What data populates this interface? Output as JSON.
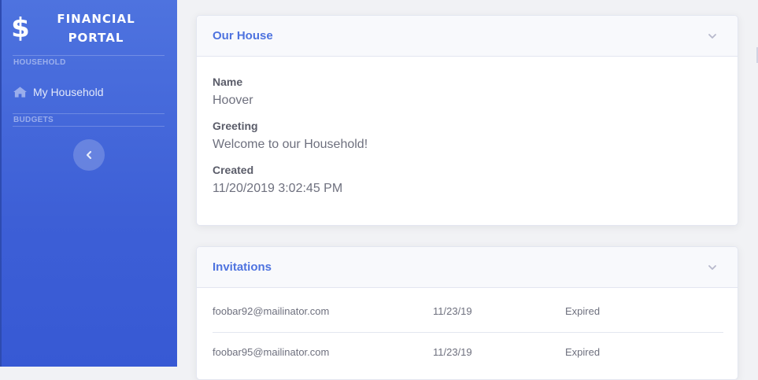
{
  "brand": {
    "title_line1": "FINANCIAL",
    "title_line2": "PORTAL",
    "icon": "dollar-icon"
  },
  "sidebar": {
    "headings": {
      "household": "HOUSEHOLD",
      "budgets": "BUDGETS"
    },
    "items": [
      {
        "label": "My Household",
        "icon": "home-icon"
      }
    ],
    "toggle_icon": "chevron-left-icon"
  },
  "house_card": {
    "title": "Our House",
    "fields": [
      {
        "label": "Name",
        "value": "Hoover"
      },
      {
        "label": "Greeting",
        "value": "Welcome to our Household!"
      },
      {
        "label": "Created",
        "value": "11/20/2019 3:02:45 PM"
      }
    ]
  },
  "invitations_card": {
    "title": "Invitations",
    "rows": [
      {
        "email": "foobar92@mailinator.com",
        "date": "11/23/19",
        "status": "Expired"
      },
      {
        "email": "foobar95@mailinator.com",
        "date": "11/23/19",
        "status": "Expired"
      }
    ]
  },
  "colors": {
    "sidebar_primary": "#4e73df",
    "accent": "#4e73df",
    "text_muted": "#6e707e"
  }
}
